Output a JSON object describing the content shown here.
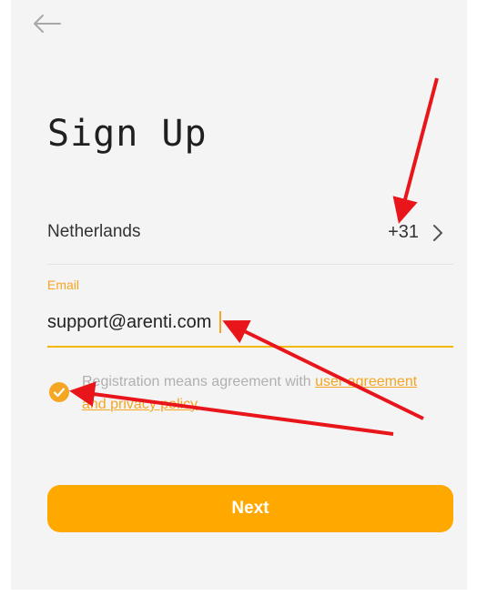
{
  "header": {
    "back_icon": "arrow-left-icon"
  },
  "title": "Sign Up",
  "country": {
    "name": "Netherlands",
    "dial_code": "+31",
    "chevron_icon": "chevron-right-icon"
  },
  "email": {
    "label": "Email",
    "value": "support@arenti.com"
  },
  "agreement": {
    "checked": true,
    "text": "Registration means agreement with ",
    "link_user": "user agreement",
    "link_joiner": " and ",
    "link_privacy": "privacy policy"
  },
  "next_button": {
    "label": "Next"
  },
  "colors": {
    "accent": "#ffa800",
    "label": "#f5a623",
    "annotation_arrow": "#e8151b",
    "background": "#f4f4f4"
  }
}
